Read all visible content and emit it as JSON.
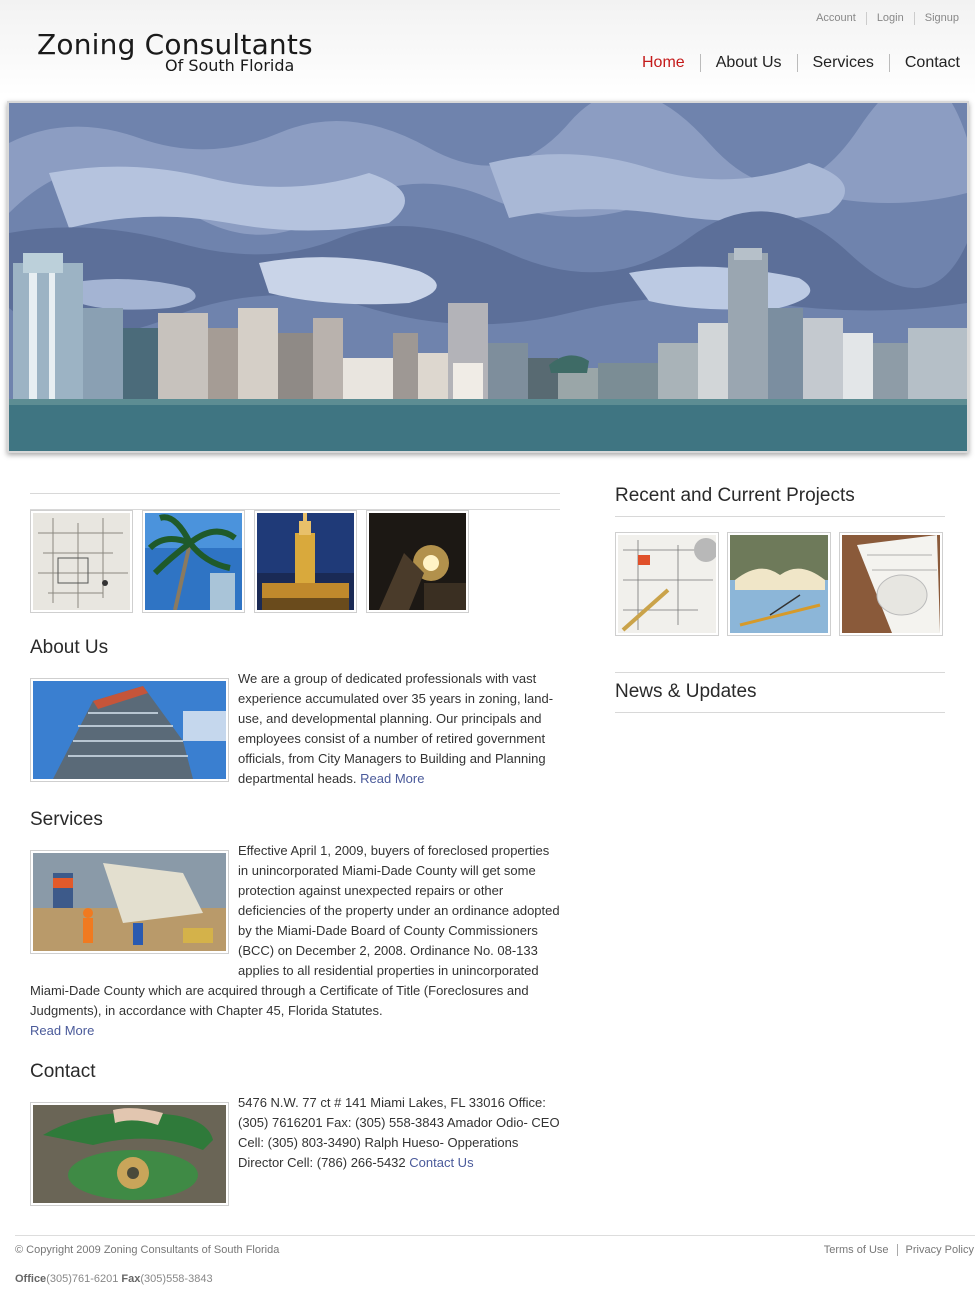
{
  "header": {
    "logo_title": "Zoning Consultants",
    "logo_subtitle": "Of South Florida",
    "utility_links": [
      "Account",
      "Login",
      "Signup"
    ],
    "main_nav": [
      {
        "label": "Home",
        "active": true
      },
      {
        "label": "About Us",
        "active": false
      },
      {
        "label": "Services",
        "active": false
      },
      {
        "label": "Contact",
        "active": false
      }
    ],
    "active_color": "#c41a1a"
  },
  "hero": {
    "image": "miami-skyline-illustration"
  },
  "gallery": {
    "thumbnails": [
      "blueprint-photo",
      "palm-trees-photo",
      "freedom-tower-photo",
      "night-construction-photo"
    ]
  },
  "about": {
    "title": "About Us",
    "image": "building-construction-photo",
    "text": "We are a group of dedicated professionals with vast experience accumulated over 35 years in zoning, land-use, and developmental planning. Our principals and employees consist of a number of retired government officials, from City Managers to Building and Planning departmental heads.",
    "link": "Read More"
  },
  "services": {
    "title": "Services",
    "image": "roadwork-crew-photo",
    "text": "Effective April 1, 2009, buyers of foreclosed properties in unincorporated Miami-Dade County will get some protection against unexpected repairs or other deficiencies of the property under an ordinance adopted by the Miami-Dade Board of County Commissioners (BCC) on December 2, 2008. Ordinance No. 08-133 applies to all residential properties in unincorporated Miami-Dade County which are acquired through a Certificate of Title (Foreclosures and Judgments), in accordance with Chapter 45, Florida Statutes.",
    "link": "Read More"
  },
  "contact": {
    "title": "Contact",
    "image": "rotary-phone-photo",
    "text": "5476 N.W. 77 ct # 141 Miami Lakes, FL 33016 Office:(305) 7616201 Fax: (305) 558-3843 Amador Odio- CEO Cell: (305) 803-3490) Ralph Hueso- Opperations Director Cell: (786) 266-5432",
    "link": "Contact Us"
  },
  "sidebar": {
    "projects_title": "Recent and Current Projects",
    "project_thumbnails": [
      "floorplan-pencil-photo",
      "books-blueprint-photo",
      "rolled-plans-photo"
    ],
    "news_title": "News & Updates"
  },
  "footer": {
    "copyright": "© Copyright 2009 Zoning Consultants of South Florida",
    "links": [
      "Terms of Use",
      "Privacy Policy"
    ],
    "office_label": "Office",
    "office_number": "(305)761-6201",
    "fax_label": "Fax",
    "fax_number": "(305)558-3843"
  }
}
